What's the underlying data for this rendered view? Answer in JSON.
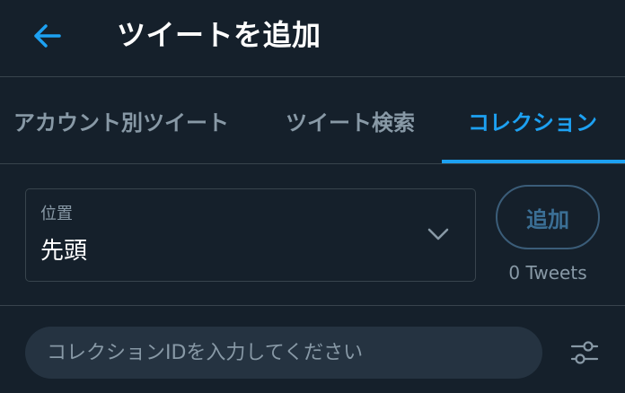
{
  "header": {
    "title": "ツイートを追加",
    "back_icon": "arrow-left-icon"
  },
  "tabs": [
    {
      "label": "アカウント別ツイート",
      "active": false
    },
    {
      "label": "ツイート検索",
      "active": false
    },
    {
      "label": "コレクション",
      "active": true
    }
  ],
  "position_select": {
    "label": "位置",
    "value": "先頭",
    "icon": "chevron-down-icon"
  },
  "add_button": {
    "label": "追加"
  },
  "tweet_count": "0 Tweets",
  "collection_input": {
    "placeholder": "コレクションIDを入力してください",
    "value": ""
  },
  "filter_icon": "sliders-icon",
  "colors": {
    "background": "#15202b",
    "accent": "#1da1f2",
    "border": "#38444d",
    "muted_text": "#8899a6",
    "input_background": "#253341"
  }
}
